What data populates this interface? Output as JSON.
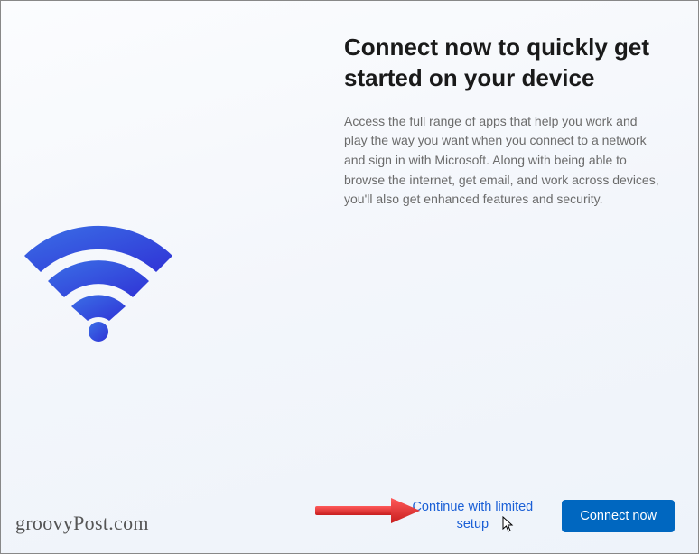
{
  "main": {
    "heading": "Connect now to quickly get started on your device",
    "body": "Access the full range of apps that help you work and play the way you want when you connect to a network and sign in with Microsoft. Along with being able to browse the internet, get email, and work across devices, you'll also get enhanced features and security."
  },
  "footer": {
    "secondary_label": "Continue with limited setup",
    "primary_label": "Connect now"
  },
  "watermark": "groovyPost.com"
}
